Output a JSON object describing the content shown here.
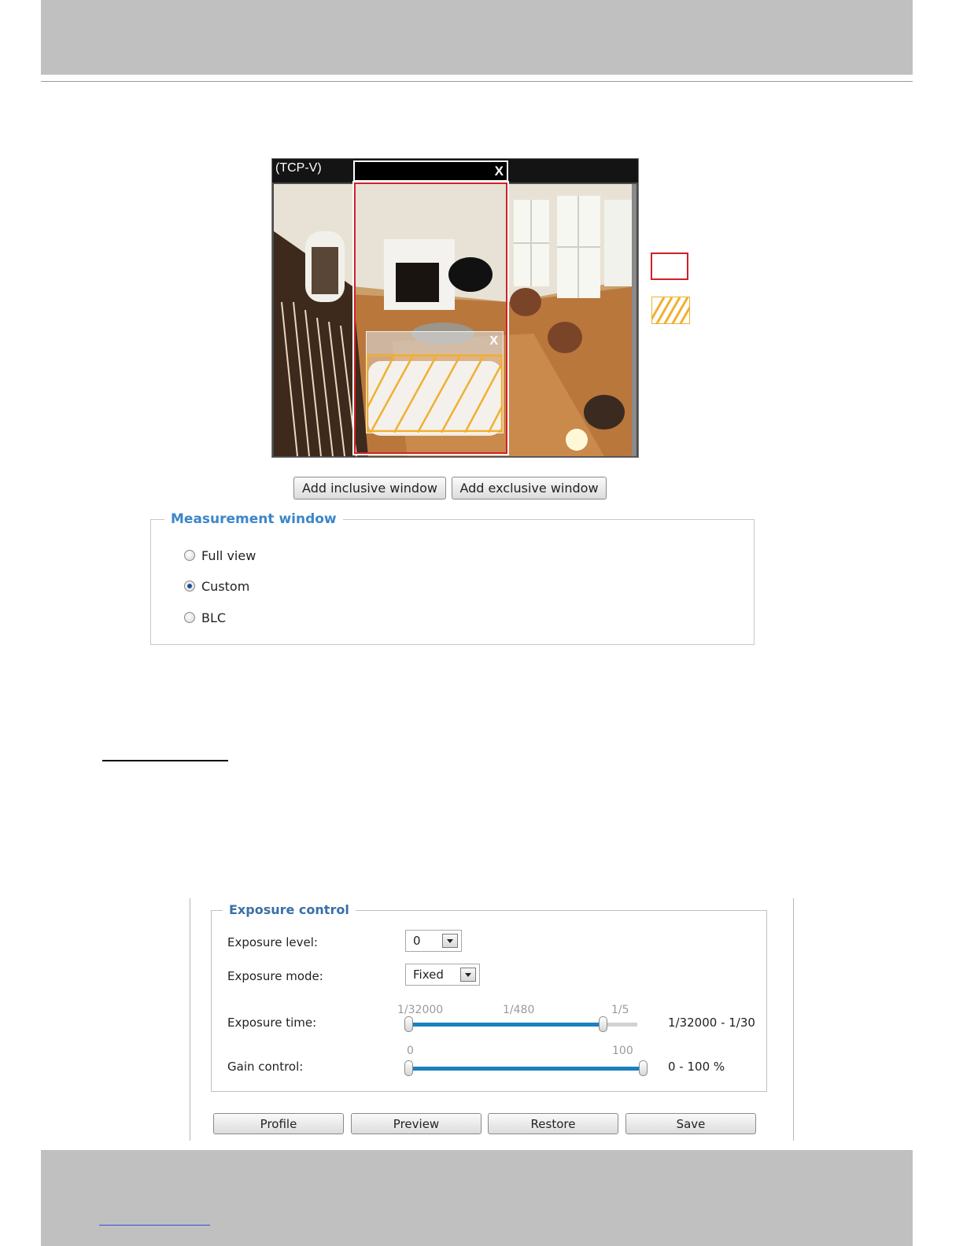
{
  "video": {
    "protocol_label": "(TCP-V)",
    "close_glyph": "X"
  },
  "buttons": {
    "add_inclusive": "Add inclusive window",
    "add_exclusive": "Add exclusive window"
  },
  "measurement_window": {
    "title": "Measurement window",
    "options": [
      {
        "label": "Full view",
        "selected": false
      },
      {
        "label": "Custom",
        "selected": true
      },
      {
        "label": "BLC",
        "selected": false
      }
    ]
  },
  "exposure_control": {
    "title": "Exposure control",
    "exposure_level": {
      "label": "Exposure level:",
      "value": "0"
    },
    "exposure_mode": {
      "label": "Exposure mode:",
      "value": "Fixed"
    },
    "exposure_time": {
      "label": "Exposure time:",
      "ticks": [
        "1/32000",
        "1/480",
        "1/5"
      ],
      "range_text": "1/32000 - 1/30",
      "min_fraction": 0.0,
      "max_fraction": 0.85
    },
    "gain_control": {
      "label": "Gain control:",
      "ticks": [
        "0",
        "100"
      ],
      "range_text": "0 - 100 %",
      "min_fraction": 0.0,
      "max_fraction": 1.0
    },
    "actions": {
      "profile": "Profile",
      "preview": "Preview",
      "restore": "Restore",
      "save": "Save"
    }
  },
  "colors": {
    "inclusive_window": "#d0202a",
    "exclusive_window": "#f0b030",
    "legend_title": "#3a86c8",
    "slider_fill": "#1c7fc0"
  }
}
